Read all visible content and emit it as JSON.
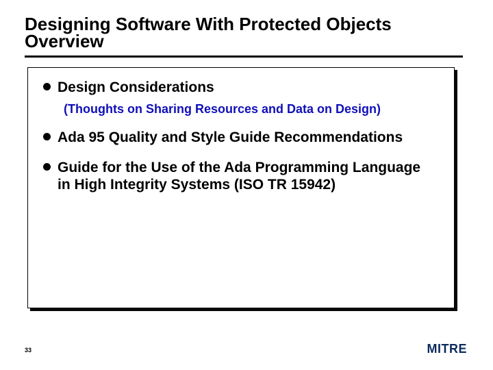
{
  "title": "Designing Software With Protected Objects",
  "subtitle": "Overview",
  "bullets": [
    {
      "text": "Design Considerations",
      "sub": "(Thoughts on  Sharing Resources and Data on Design)"
    },
    {
      "text": "Ada 95 Quality and Style Guide Recommendations"
    },
    {
      "text": "Guide for the Use of the Ada Programming Language in High Integrity Systems (ISO TR 15942)"
    }
  ],
  "page_number": "33",
  "logo": "MITRE"
}
